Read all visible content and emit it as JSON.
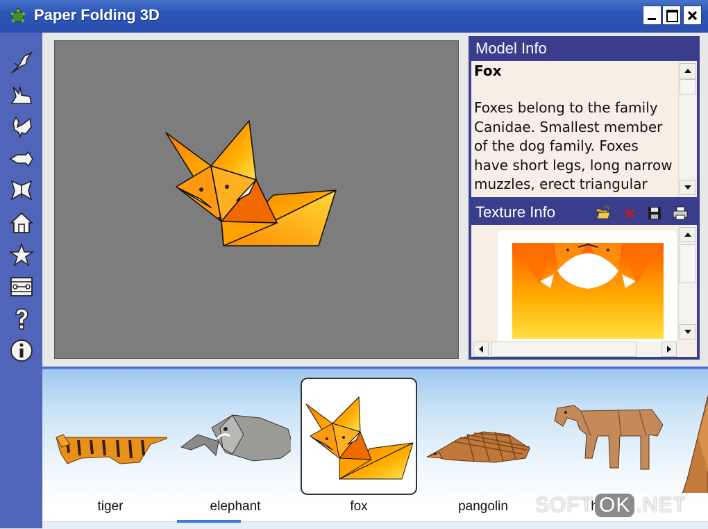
{
  "window": {
    "title": "Paper Folding 3D"
  },
  "toolbar": {
    "icons": [
      "bird-icon",
      "rabbit-icon",
      "rooster-icon",
      "fish-icon",
      "butterfly-icon",
      "house-icon",
      "star-icon",
      "layout-icon",
      "help-icon",
      "info-icon"
    ]
  },
  "model_info": {
    "header": "Model Info",
    "name": "Fox",
    "description": "Foxes belong to the family Canidae. Smallest member of the dog family. Foxes have short legs, long narrow muzzles, erect triangular"
  },
  "texture_info": {
    "header": "Texture Info"
  },
  "gallery": {
    "items": [
      {
        "label": "tiger"
      },
      {
        "label": "elephant"
      },
      {
        "label": "fox",
        "selected": true
      },
      {
        "label": "pangolin"
      },
      {
        "label": "horse"
      }
    ]
  },
  "watermark": {
    "left": "SOFT",
    "ok": "OK",
    "right": ".NET"
  },
  "colors": {
    "titlebar": "#2c54b8",
    "sidebar": "#5064b9",
    "panel_header": "#3a3d8c",
    "viewport": "#7d7d7d"
  }
}
